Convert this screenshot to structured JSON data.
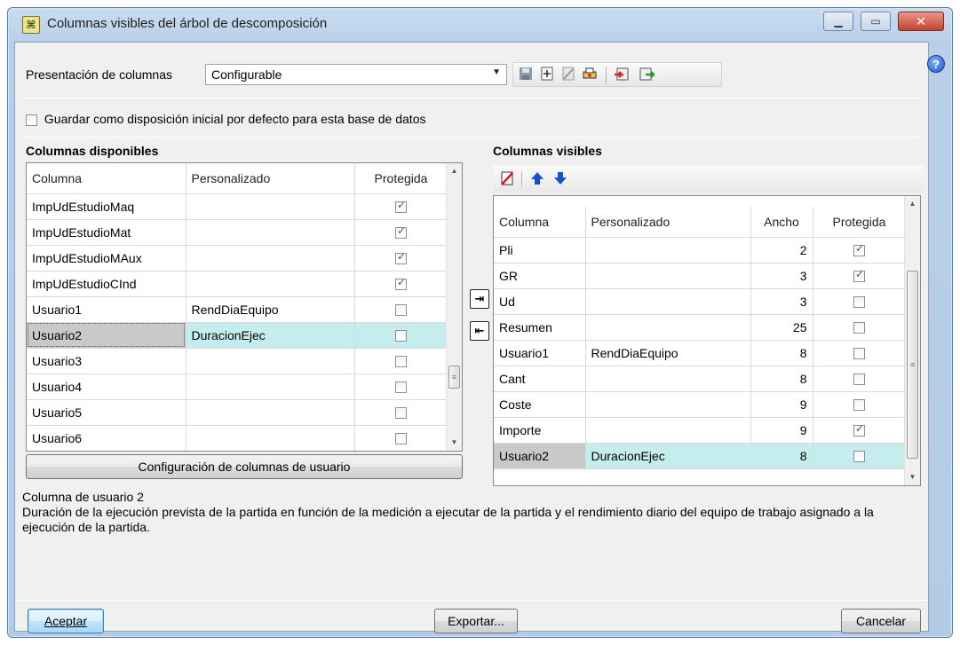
{
  "window": {
    "title": "Columnas visibles del árbol de descomposición",
    "title_icon": "tree-columns-icon",
    "minimize_glyph": "▁",
    "maximize_glyph": "▭",
    "close_glyph": "✕"
  },
  "header": {
    "presentation_label": "Presentación de columnas",
    "presentation_value": "Configurable",
    "toolbar_icons": [
      "save-icon",
      "add-icon",
      "clear-icon",
      "print-icon",
      "import-icon",
      "export-icon"
    ]
  },
  "default_layout_checkbox": {
    "label": "Guardar como disposición inicial por defecto para esta base de datos",
    "checked": false
  },
  "available": {
    "title": "Columnas disponibles",
    "headers": [
      "Columna",
      "Personalizado",
      "Protegida"
    ],
    "rows": [
      {
        "col": "ImpUdEstudioMaq",
        "custom": "",
        "protected": true
      },
      {
        "col": "ImpUdEstudioMat",
        "custom": "",
        "protected": true
      },
      {
        "col": "ImpUdEstudioMAux",
        "custom": "",
        "protected": true
      },
      {
        "col": "ImpUdEstudioCInd",
        "custom": "",
        "protected": true
      },
      {
        "col": "Usuario1",
        "custom": "RendDiaEquipo",
        "protected": false
      },
      {
        "col": "Usuario2",
        "custom": "DuracionEjec",
        "protected": false,
        "selected": true
      },
      {
        "col": "Usuario3",
        "custom": "",
        "protected": false
      },
      {
        "col": "Usuario4",
        "custom": "",
        "protected": false
      },
      {
        "col": "Usuario5",
        "custom": "",
        "protected": false
      },
      {
        "col": "Usuario6",
        "custom": "",
        "protected": false
      }
    ],
    "config_button": "Configuración de columnas de usuario"
  },
  "visible": {
    "title": "Columnas visibles",
    "headers": [
      "Columna",
      "Personalizado",
      "Ancho",
      "Protegida"
    ],
    "rows": [
      {
        "col": "Pli",
        "custom": "",
        "width": "2",
        "protected": true
      },
      {
        "col": "GR",
        "custom": "",
        "width": "3",
        "protected": true
      },
      {
        "col": "Ud",
        "custom": "",
        "width": "3",
        "protected": false
      },
      {
        "col": "Resumen",
        "custom": "",
        "width": "25",
        "protected": false
      },
      {
        "col": "Usuario1",
        "custom": "RendDiaEquipo",
        "width": "8",
        "protected": false
      },
      {
        "col": "Cant",
        "custom": "",
        "width": "8",
        "protected": false
      },
      {
        "col": "Coste",
        "custom": "",
        "width": "9",
        "protected": false
      },
      {
        "col": "Importe",
        "custom": "",
        "width": "9",
        "protected": true
      },
      {
        "col": "Usuario2",
        "custom": "DuracionEjec",
        "width": "8",
        "protected": false,
        "selected": true
      }
    ]
  },
  "description": {
    "title": "Columna de usuario 2",
    "text": "Duración de la ejecución prevista de la partida en función de la medición a ejecutar de la partida y el rendimiento diario del equipo de trabajo asignado a la ejecución de la partida."
  },
  "footer": {
    "accept": "Aceptar",
    "export": "Exportar...",
    "cancel": "Cancelar"
  },
  "colors": {
    "selected_row": "#c6eded",
    "title_gradient": "#c9dcf0"
  }
}
